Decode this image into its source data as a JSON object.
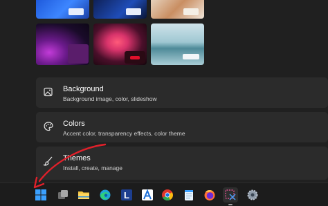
{
  "wallpapers": [
    {
      "name": "bloom-blue"
    },
    {
      "name": "bloom-dark"
    },
    {
      "name": "beige-abstract"
    },
    {
      "name": "glow-purple"
    },
    {
      "name": "flower-red"
    },
    {
      "name": "lake-landscape"
    }
  ],
  "settings": {
    "background": {
      "title": "Background",
      "subtitle": "Background image, color, slideshow",
      "icon": "image-icon"
    },
    "colors": {
      "title": "Colors",
      "subtitle": "Accent color, transparency effects, color theme",
      "icon": "palette-icon"
    },
    "themes": {
      "title": "Themes",
      "subtitle": "Install, create, manage",
      "icon": "brush-icon"
    }
  },
  "taskbar": {
    "apps": [
      "start-icon",
      "task-view-icon",
      "file-explorer-icon",
      "edge-icon",
      "l-app-icon",
      "a-app-icon",
      "chrome-icon",
      "notepad-icon",
      "firefox-icon",
      "snipping-tool-icon",
      "settings-icon"
    ]
  },
  "colors": {
    "background": "#202020",
    "card": "#2b2b2b",
    "taskbar": "#1c1c1c",
    "annotation_arrow": "#e0202a"
  }
}
